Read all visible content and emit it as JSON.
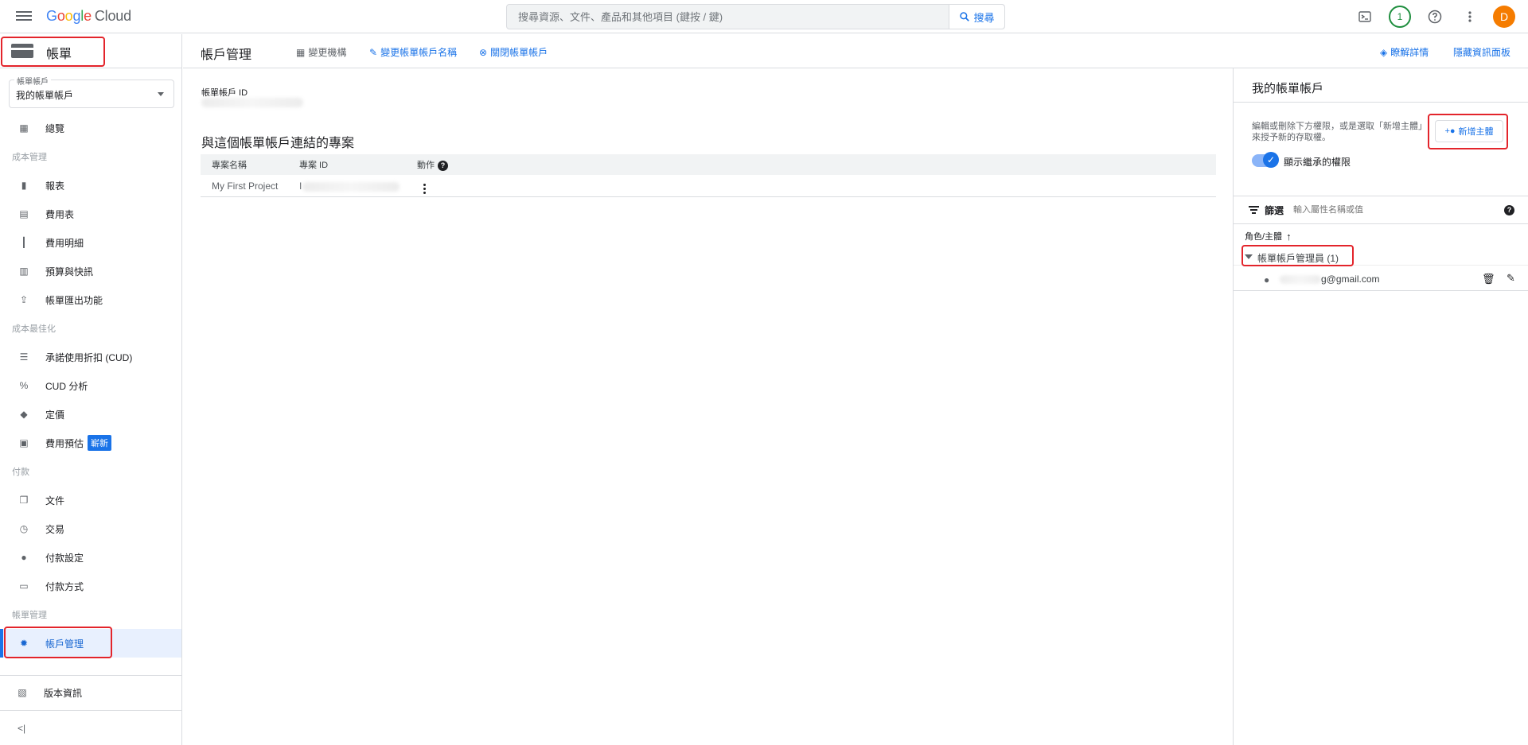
{
  "topbar": {
    "logo_letters": [
      "G",
      "o",
      "o",
      "g",
      "l",
      "e"
    ],
    "logo_suffix": "Cloud",
    "search_placeholder": "搜尋資源、文件、產品和其他項目 (鍵按 / 鍵)",
    "search_button": "搜尋",
    "notification_count": "1",
    "avatar_initial": "D"
  },
  "sidebar": {
    "title": "帳單",
    "account_label": "帳單帳戶",
    "account_value": "我的帳單帳戶",
    "overview": "總覽",
    "section_cost_mgmt": "成本管理",
    "reports": "報表",
    "cost_table": "費用表",
    "cost_breakdown": "費用明細",
    "budgets": "預算與快訊",
    "billing_export": "帳單匯出功能",
    "section_cost_opt": "成本最佳化",
    "cud": "承諾使用折扣 (CUD)",
    "cud_analysis": "CUD 分析",
    "pricing": "定價",
    "cost_estimate": "費用預估",
    "new_badge": "嶄新",
    "section_payments": "付款",
    "documents": "文件",
    "transactions": "交易",
    "payment_settings": "付款設定",
    "payment_method": "付款方式",
    "section_billing_mgmt": "帳單管理",
    "account_mgmt": "帳戶管理",
    "release_notes": "版本資訊",
    "collapse": "<|"
  },
  "header": {
    "page_title": "帳戶管理",
    "change_org": "變更機構",
    "rename_account": "變更帳單帳戶名稱",
    "close_account": "關閉帳單帳戶",
    "learn_more": "瞭解詳情",
    "hide_info_panel": "隱藏資訊面板"
  },
  "main": {
    "account_id_label": "帳單帳戶 ID",
    "projects_title": "與這個帳單帳戶連結的專案",
    "table_headers": {
      "name": "專案名稱",
      "id": "專案 ID",
      "actions": "動作"
    },
    "rows": [
      {
        "name": "My First Project",
        "id_prefix": "I"
      }
    ]
  },
  "info_panel": {
    "title": "我的帳單帳戶",
    "description": "編輯或刪除下方權限，或是選取「新增主體」來授予新的存取權。",
    "add_principal": "新增主體",
    "show_inherited": "顯示繼承的權限",
    "filter_label": "篩選",
    "filter_placeholder": "輸入屬性名稱或值",
    "roles_header": "角色/主體",
    "role_name": "帳單帳戶管理員 (1)",
    "member_email": "g@gmail.com"
  },
  "colors": {
    "accent": "#1a73e8",
    "highlight": "#e3242b",
    "avatar": "#f57c00",
    "notification": "#1e8e3e"
  }
}
